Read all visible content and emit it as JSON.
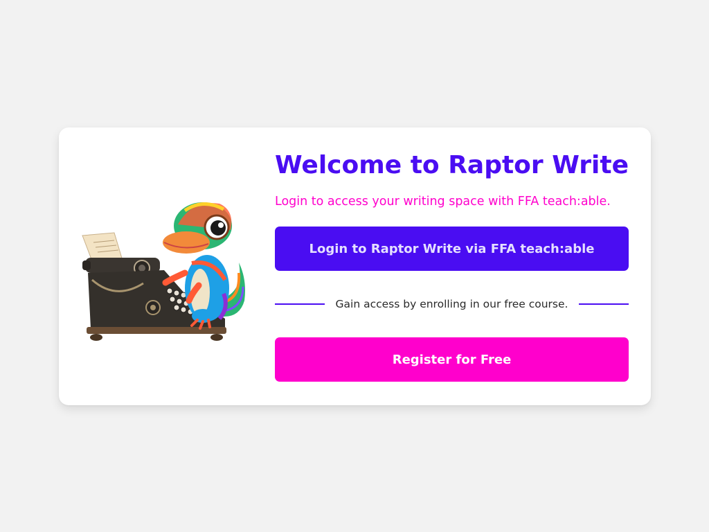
{
  "colors": {
    "primary": "#4a0df2",
    "accent": "#ff00cc",
    "background": "#f2f2f2",
    "card": "#ffffff"
  },
  "hero": {
    "illustration_icon": "raptor-typewriter-icon"
  },
  "content": {
    "title": "Welcome to Raptor Write",
    "subtitle": "Login to access your writing space with FFA teach:able.",
    "login_label": "Login to Raptor Write via FFA teach:able",
    "divider_text": "Gain access by enrolling in our free course.",
    "register_label": "Register for Free"
  }
}
